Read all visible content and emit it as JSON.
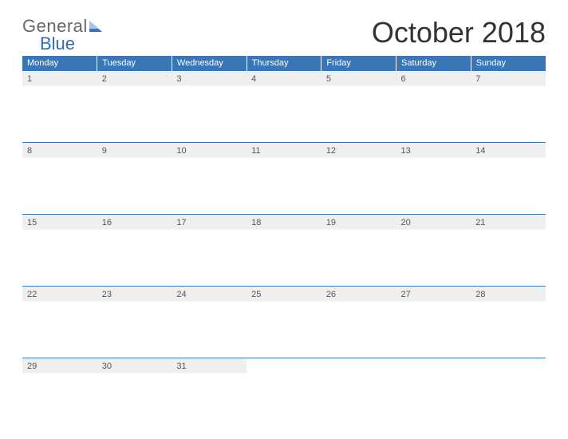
{
  "logo": {
    "part1": "General",
    "part2": "Blue"
  },
  "title": "October 2018",
  "days": [
    "Monday",
    "Tuesday",
    "Wednesday",
    "Thursday",
    "Friday",
    "Saturday",
    "Sunday"
  ],
  "weeks": [
    [
      "1",
      "2",
      "3",
      "4",
      "5",
      "6",
      "7"
    ],
    [
      "8",
      "9",
      "10",
      "11",
      "12",
      "13",
      "14"
    ],
    [
      "15",
      "16",
      "17",
      "18",
      "19",
      "20",
      "21"
    ],
    [
      "22",
      "23",
      "24",
      "25",
      "26",
      "27",
      "28"
    ],
    [
      "29",
      "30",
      "31",
      "",
      "",
      "",
      ""
    ]
  ]
}
